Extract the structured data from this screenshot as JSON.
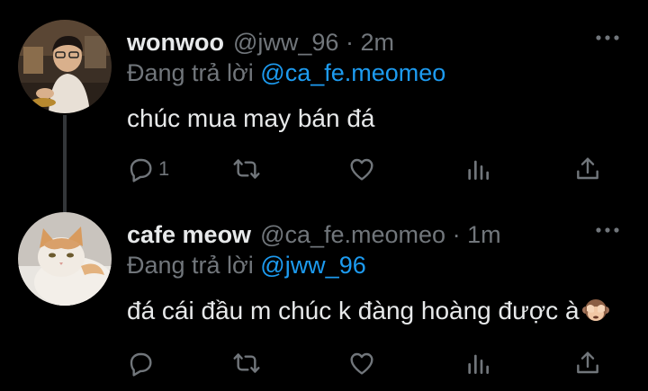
{
  "tweets": [
    {
      "display_name": "wonwoo",
      "handle": "@jww_96",
      "dot": "·",
      "time": "2m",
      "replying_prefix": "Đang trả lời",
      "replying_to": "@ca_fe.meomeo",
      "text": "chúc mua may bán đá",
      "reply_count": "1",
      "more_icon": "more-horizontal-icon"
    },
    {
      "display_name": "cafe meow",
      "handle": "@ca_fe.meomeo",
      "dot": "·",
      "time": "1m",
      "replying_prefix": "Đang trả lời",
      "replying_to": "@jww_96",
      "text": "đá cái đầu m chúc k đàng hoàng được à",
      "emoji": "see-no-evil-monkey",
      "reply_count": "",
      "more_icon": "more-horizontal-icon"
    }
  ],
  "colors": {
    "background": "#000000",
    "primary_text": "#e7e9ea",
    "secondary_text": "#71767b",
    "link": "#1d9bf0",
    "thread_line": "#333639"
  }
}
